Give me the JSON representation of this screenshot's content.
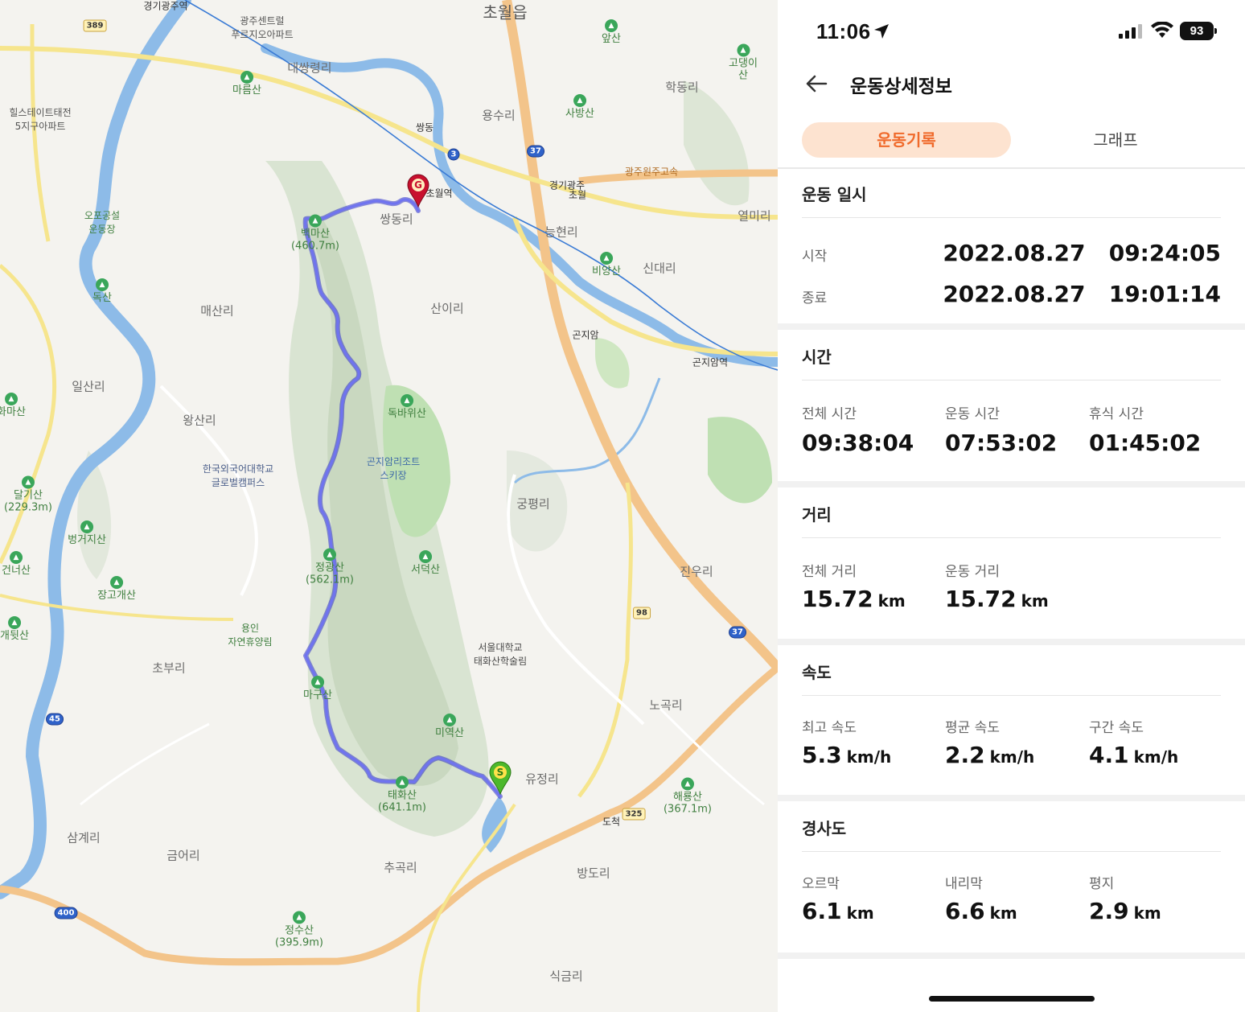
{
  "status_bar": {
    "time": "11:06",
    "battery": "93"
  },
  "header": {
    "title": "운동상세정보"
  },
  "tabs": [
    {
      "label": "운동기록",
      "active": true
    },
    {
      "label": "그래프",
      "active": false
    }
  ],
  "exercise_datetime": {
    "title": "운동 일시",
    "start_label": "시작",
    "start_value": "2022.08.27   09:24:05",
    "end_label": "종료",
    "end_value": "2022.08.27   19:01:14"
  },
  "time": {
    "title": "시간",
    "items": [
      {
        "label": "전체 시간",
        "value": "09:38:04"
      },
      {
        "label": "운동 시간",
        "value": "07:53:02"
      },
      {
        "label": "휴식 시간",
        "value": "01:45:02"
      }
    ]
  },
  "distance": {
    "title": "거리",
    "items": [
      {
        "label": "전체 거리",
        "value": "15.72",
        "unit": "km"
      },
      {
        "label": "운동 거리",
        "value": "15.72",
        "unit": "km"
      }
    ]
  },
  "speed": {
    "title": "속도",
    "items": [
      {
        "label": "최고 속도",
        "value": "5.3",
        "unit": "km/h"
      },
      {
        "label": "평균 속도",
        "value": "2.2",
        "unit": "km/h"
      },
      {
        "label": "구간 속도",
        "value": "4.1",
        "unit": "km/h"
      }
    ]
  },
  "slope": {
    "title": "경사도",
    "items": [
      {
        "label": "오르막",
        "value": "6.1",
        "unit": "km"
      },
      {
        "label": "내리막",
        "value": "6.6",
        "unit": "km"
      },
      {
        "label": "평지",
        "value": "2.9",
        "unit": "km"
      }
    ]
  },
  "map": {
    "labels": {
      "chowol_eup": "초월읍",
      "ssangdong_ri": "쌍동리",
      "daessangnyeong_ri": "대쌍령리",
      "yongsu_ri": "용수리",
      "hakdong_ri": "학동리",
      "yeolmi_ri": "열미리",
      "neunghyeon_ri": "능현리",
      "sindae_ri": "신대리",
      "maesan_ri": "매산리",
      "san_i_ri": "산이리",
      "ilsan_ri": "일산리",
      "wangsan_ri": "왕산리",
      "gungpyeong_ri": "궁평리",
      "jinu_ri": "진우리",
      "chobu_ri": "초부리",
      "nogok_ri": "노곡리",
      "yujeong_ri": "유정리",
      "samgye_ri": "삼계리",
      "geumeo_ri": "금어리",
      "chugok_ri": "추곡리",
      "bangdo_ri": "방도리",
      "sikgeum_ri": "식금리",
      "chowol_station": "초월역",
      "gonjiam_station": "곤지암역",
      "gyeonggi_gwangju_station": "경기광주역",
      "ssangdong_jc": "쌍동",
      "gyeonggi_gwangju_jc": "경기광주",
      "chowol_ic": "초월",
      "gonjiam_ic": "곤지암",
      "docheok_ic": "도척",
      "gwangju_wonju_expressway": "광주원주고속",
      "hankuk_univ": "한국외국어대학교\n글로벌캠퍼스",
      "seoul_univ_forest": "서울대학교\n태화산학술림",
      "gonjiam_resort": "곤지암리조트\n스키장",
      "yongin_forest": "용인\n자연휴양림",
      "opo_sports": "오포공설\n운동장",
      "hillstate": "힐스테이트태전\n5지구아파트",
      "gwangju_center": "광주센트럴\n푸르지오아파트"
    },
    "mountains": {
      "baekmasan": "백마산\n(460.7m)",
      "masan": "마름산",
      "doksan": "독산",
      "dokbawisan": "독바위산",
      "jeonggwangsan": "정광산\n(562.1m)",
      "seodeoksan": "서덕산",
      "madusan": "마구산",
      "miryeoksan": "미역산",
      "taehwasan": "태화산\n(641.1m)",
      "dalgisan": "달기산\n(229.3m)",
      "beomgeojisan": "벙거지산",
      "janggogaesan": "장고개산",
      "geonneosan": "건너산",
      "gaetwisan": "개뒷산",
      "jeongsusan": "정수산\n(395.9m)",
      "haeryongsan": "해룡산\n(367.1m)",
      "apsan": "앞산",
      "godaengisan": "고댕이산",
      "sabangsan": "사방산",
      "biyangsan": "비양산",
      "hwamasan": "화마산"
    },
    "route_shields": [
      "389",
      "3",
      "37",
      "98",
      "37",
      "45",
      "400",
      "325"
    ],
    "start_marker": "S",
    "goal_marker": "G"
  },
  "colors": {
    "accent": "#f06a2b",
    "tab_active_bg": "#fde3d0",
    "route": "#4b4fd8",
    "river": "#7fb6ea",
    "highway": "#f2c98a"
  }
}
